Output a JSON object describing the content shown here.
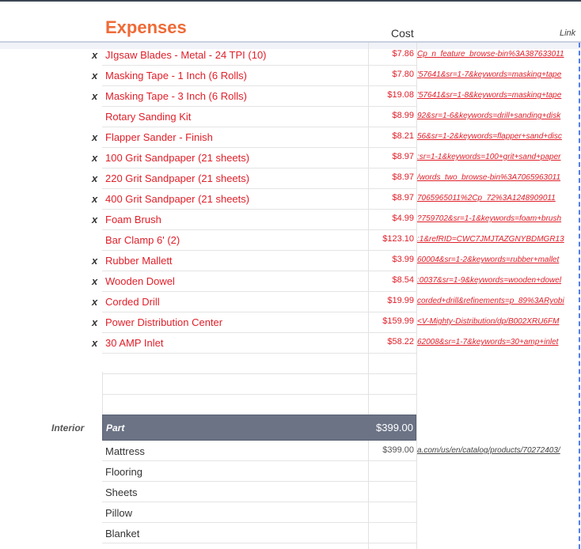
{
  "header": {
    "title": "Expenses",
    "cost_col": "Cost",
    "link_col": "Link"
  },
  "items": [
    {
      "mark": "x",
      "name": "JIgsaw Blades - Metal - 24 TPI (10)",
      "cost": "$7.86",
      "link": "Cp_n_feature_browse-bin%3A387633011"
    },
    {
      "mark": "x",
      "name": "Masking Tape - 1 Inch (6 Rolls)",
      "cost": "$7.80",
      "link": "'57641&sr=1-7&keywords=masking+tape"
    },
    {
      "mark": "x",
      "name": "Masking Tape - 3 Inch (6 Rolls)",
      "cost": "$19.08",
      "link": "'57641&sr=1-8&keywords=masking+tape"
    },
    {
      "mark": "",
      "name": "Rotary Sanding Kit",
      "cost": "$8.99",
      "link": "92&sr=1-6&keywords=drill+sanding+disk"
    },
    {
      "mark": "x",
      "name": "Flapper Sander - Finish",
      "cost": "$8.21",
      "link": "56&sr=1-2&keywords=flapper+sand+disc"
    },
    {
      "mark": "x",
      "name": "100 Grit Sandpaper (21 sheets)",
      "cost": "$8.97",
      "link": ":sr=1-1&keywords=100+grit+sand+paper"
    },
    {
      "mark": "x",
      "name": "220 Grit Sandpaper (21 sheets)",
      "cost": "$8.97",
      "link": "/words_two_browse-bin%3A7065963011"
    },
    {
      "mark": "x",
      "name": "400 Grit Sandpaper (21 sheets)",
      "cost": "$8.97",
      "link": "7065965011%2Cp_72%3A1248909011"
    },
    {
      "mark": "x",
      "name": "Foam Brush",
      "cost": "$4.99",
      "link": "?759702&sr=1-1&keywords=foam+brush"
    },
    {
      "mark": "",
      "name": "Bar Clamp 6' (2)",
      "cost": "$123.10",
      "link": ":1&refRID=CWC7JMJTAZGNYBDMGR13"
    },
    {
      "mark": "x",
      "name": "Rubber Mallett",
      "cost": "$3.99",
      "link": "60004&sr=1-2&keywords=rubber+mallet"
    },
    {
      "mark": "x",
      "name": "Wooden Dowel",
      "cost": "$8.54",
      "link": ":0037&sr=1-9&keywords=wooden+dowel"
    },
    {
      "mark": "x",
      "name": "Corded Drill",
      "cost": "$19.99",
      "link": "corded+drill&refinements=p_89%3ARyobi"
    },
    {
      "mark": "x",
      "name": "Power Distribution Center",
      "cost": "$159.99",
      "link": "<V-Mighty-Distribution/dp/B002XRU6FM"
    },
    {
      "mark": "x",
      "name": "30 AMP Inlet",
      "cost": "$58.22",
      "link": "62008&sr=1-7&keywords=30+amp+inlet"
    },
    {
      "mark": "",
      "name": "",
      "cost": "",
      "link": ""
    },
    {
      "mark": "",
      "name": "",
      "cost": "",
      "link": ""
    },
    {
      "mark": "",
      "name": "",
      "cost": "",
      "link": ""
    }
  ],
  "interior": {
    "label": "Interior",
    "part_header": "Part",
    "total": "$399.00",
    "items": [
      {
        "name": "Mattress",
        "cost": "$399.00",
        "link": "a.com/us/en/catalog/products/70272403/"
      },
      {
        "name": "Flooring",
        "cost": "",
        "link": ""
      },
      {
        "name": "Sheets",
        "cost": "",
        "link": ""
      },
      {
        "name": "Pillow",
        "cost": "",
        "link": ""
      },
      {
        "name": "Blanket",
        "cost": "",
        "link": ""
      }
    ]
  }
}
